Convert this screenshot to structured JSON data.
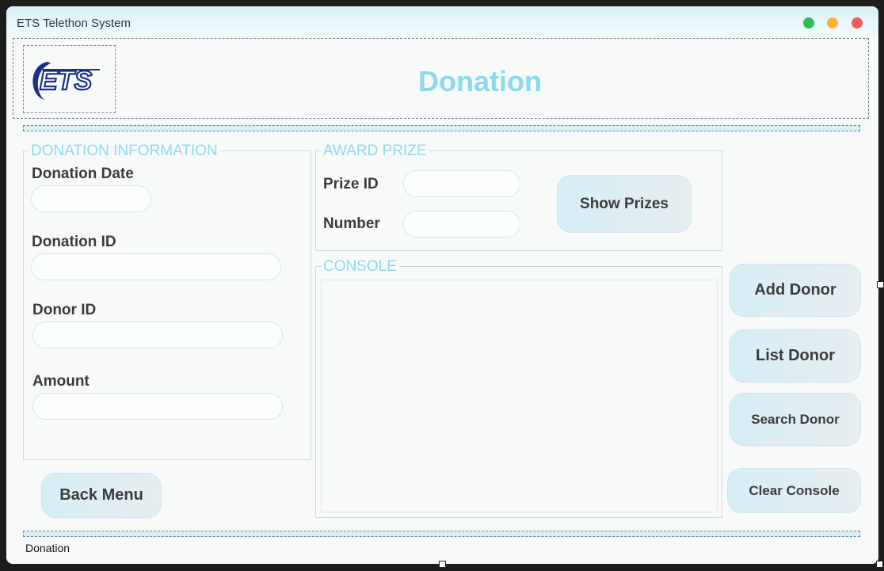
{
  "window": {
    "title": "ETS Telethon System"
  },
  "header": {
    "logo_text": "ETS",
    "title": "Donation"
  },
  "donation_info": {
    "legend": "DONATION INFORMATION",
    "date_label": "Donation Date",
    "date_value": "",
    "id_label": "Donation ID",
    "id_value": "",
    "donor_id_label": "Donor ID",
    "donor_id_value": "",
    "amount_label": "Amount",
    "amount_value": ""
  },
  "award_prize": {
    "legend": "AWARD PRIZE",
    "prize_id_label": "Prize ID",
    "prize_id_value": "",
    "number_label": "Number",
    "number_value": "",
    "show_prizes_label": "Show Prizes"
  },
  "console": {
    "legend": "CONSOLE",
    "content": ""
  },
  "buttons": {
    "add_donor": "Add Donor",
    "list_donor": "List Donor",
    "search_donor": "Search Donor",
    "clear_console": "Clear Console",
    "back_menu": "Back Menu"
  },
  "status": {
    "text": "Donation"
  },
  "colors": {
    "accent": "#8fdaee",
    "close": "#f25c5c",
    "minimize": "#f8b53d",
    "maximize": "#2dbf55",
    "logo": "#1a2e8c"
  }
}
